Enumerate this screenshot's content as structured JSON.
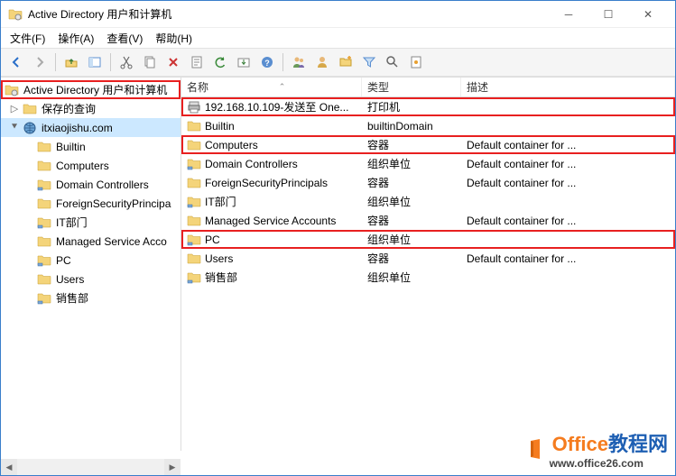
{
  "window": {
    "title": "Active Directory 用户和计算机",
    "menu": {
      "file": "文件(F)",
      "action": "操作(A)",
      "view": "查看(V)",
      "help": "帮助(H)"
    }
  },
  "tree": {
    "root": "Active Directory 用户和计算机",
    "saved": "保存的查询",
    "domain": "itxiaojishu.com",
    "items": [
      "Builtin",
      "Computers",
      "Domain Controllers",
      "ForeignSecurityPrincipa",
      "IT部门",
      "Managed Service Acco",
      "PC",
      "Users",
      "销售部"
    ]
  },
  "columns": {
    "name": "名称",
    "type": "类型",
    "desc": "描述"
  },
  "rows": [
    {
      "name": "192.168.10.109-发送至 One...",
      "type": "打印机",
      "desc": "",
      "icon": "printer",
      "hl": true
    },
    {
      "name": "Builtin",
      "type": "builtinDomain",
      "desc": "",
      "icon": "folder"
    },
    {
      "name": "Computers",
      "type": "容器",
      "desc": "Default container for ...",
      "icon": "folder",
      "hl": true
    },
    {
      "name": "Domain Controllers",
      "type": "组织单位",
      "desc": "Default container for ...",
      "icon": "ou"
    },
    {
      "name": "ForeignSecurityPrincipals",
      "type": "容器",
      "desc": "Default container for ...",
      "icon": "folder"
    },
    {
      "name": "IT部门",
      "type": "组织单位",
      "desc": "",
      "icon": "ou"
    },
    {
      "name": "Managed Service Accounts",
      "type": "容器",
      "desc": "Default container for ...",
      "icon": "folder"
    },
    {
      "name": "PC",
      "type": "组织单位",
      "desc": "",
      "icon": "ou",
      "hl": true
    },
    {
      "name": "Users",
      "type": "容器",
      "desc": "Default container for ...",
      "icon": "folder"
    },
    {
      "name": "销售部",
      "type": "组织单位",
      "desc": "",
      "icon": "ou"
    }
  ],
  "watermark": {
    "brand1": "Office",
    "brand2": "教程网",
    "url": "www.office26.com"
  }
}
